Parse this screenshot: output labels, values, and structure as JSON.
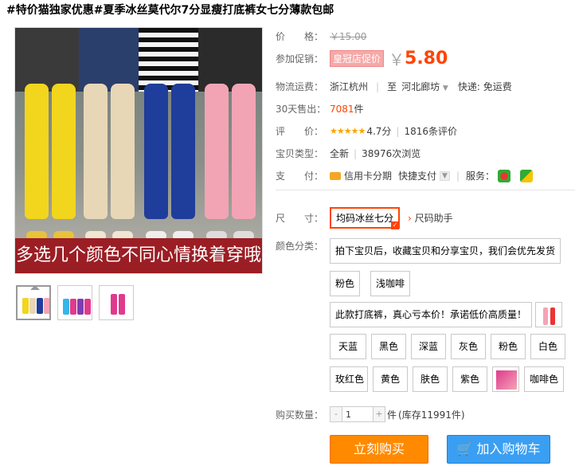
{
  "title": "#特价猫独家优惠#夏季冰丝莫代尔7分显瘦打底裤女七分薄款包邮",
  "main_image": {
    "banner_text": "多选几个颜色不同心情换着穿哦",
    "leg_colors": [
      "#f2d51d",
      "#e8d7b6",
      "#1f3d9a",
      "#f2a4b4"
    ]
  },
  "thumbnails": [
    {
      "colors": [
        "#f2d51d",
        "#e8d7b6",
        "#1f3d9a",
        "#f2a4b4"
      ]
    },
    {
      "colors": [
        "#35b6e8",
        "#e03a8e",
        "#7b3fb3",
        "#e03a8e"
      ]
    },
    {
      "colors": [
        "#e03a8e"
      ]
    }
  ],
  "price": {
    "label": "价　　格：",
    "original": "￥15.00"
  },
  "promo": {
    "label": "参加促销：",
    "tag": "皇冠店促价",
    "symbol": "￥",
    "value": "5.80"
  },
  "shipping": {
    "label": "物流运费：",
    "from": "浙江杭州",
    "to_prefix": "至",
    "to": "河北廊坊",
    "fee": "快递: 免运费"
  },
  "sales": {
    "label": "30天售出：",
    "count": "7081",
    "unit": "件"
  },
  "rating": {
    "label": "评　　价：",
    "stars": "★★★★★",
    "score": "4.7分",
    "reviews": "1816条评价"
  },
  "item_type": {
    "label": "宝贝类型：",
    "condition": "全新",
    "views": "38976次浏览"
  },
  "payment": {
    "label": "支　　付：",
    "credit": "信用卡分期",
    "quick": "快捷支付",
    "service_label": "服务："
  },
  "size": {
    "label": "尺　　寸：",
    "selected": "均码冰丝七分",
    "helper": "尺码助手"
  },
  "color": {
    "label": "颜色分类：",
    "options": [
      "拍下宝贝后，收藏宝贝和分享宝贝，我们会优先发货",
      "粉色",
      "浅咖啡",
      "此款打底裤，真心亏本价！承诺低价高质量！",
      "天蓝",
      "黑色",
      "深蓝",
      "灰色",
      "粉色",
      "白色",
      "玫红色",
      "黄色",
      "肤色",
      "紫色",
      "咖啡色"
    ]
  },
  "quantity": {
    "label": "购买数量：",
    "minus": "-",
    "value": "1",
    "plus": "+",
    "unit": "件",
    "stock": "(库存11991件)"
  },
  "actions": {
    "buy": "立刻购买",
    "cart": "加入购物车"
  },
  "colors": {
    "accent": "#ff4400",
    "buy_button": "#ff8a00",
    "cart_button": "#3a9ff2",
    "banner": "#9b1e24"
  }
}
